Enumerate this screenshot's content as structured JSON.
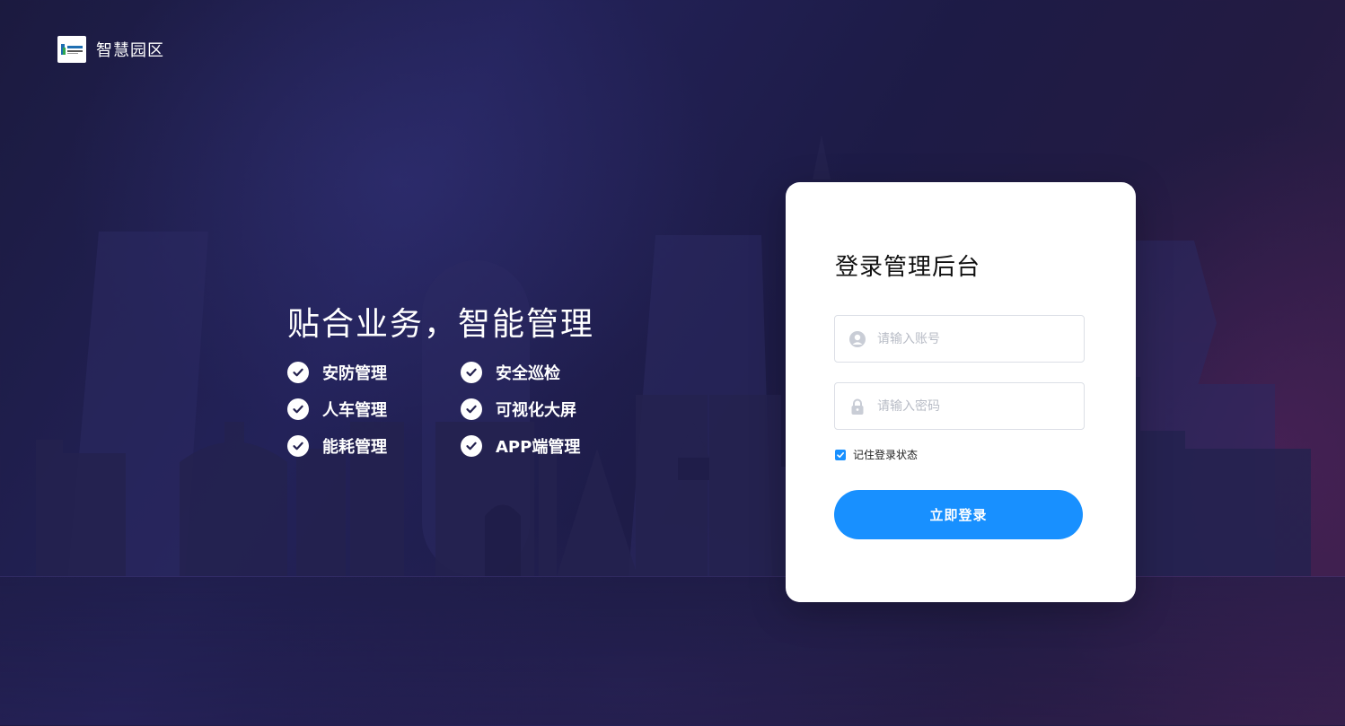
{
  "brand": {
    "logo_icon": "park-logo-icon",
    "name": "智慧园区"
  },
  "slogan": {
    "title": "贴合业务，智能管理",
    "features": [
      {
        "label": "安防管理",
        "icon": "check-circle-icon"
      },
      {
        "label": "安全巡检",
        "icon": "check-circle-icon"
      },
      {
        "label": "人车管理",
        "icon": "check-circle-icon"
      },
      {
        "label": "可视化大屏",
        "icon": "check-circle-icon"
      },
      {
        "label": "能耗管理",
        "icon": "check-circle-icon"
      },
      {
        "label": "APP端管理",
        "icon": "check-circle-icon"
      }
    ]
  },
  "login": {
    "title": "登录管理后台",
    "account": {
      "placeholder": "请输入账号",
      "value": "",
      "icon": "user-icon"
    },
    "password": {
      "placeholder": "请输入密码",
      "value": "",
      "icon": "lock-icon"
    },
    "remember": {
      "label": "记住登录状态",
      "checked": true
    },
    "submit_label": "立即登录"
  },
  "colors": {
    "accent": "#1890ff",
    "background": "#1d1b46",
    "card": "#ffffff"
  }
}
